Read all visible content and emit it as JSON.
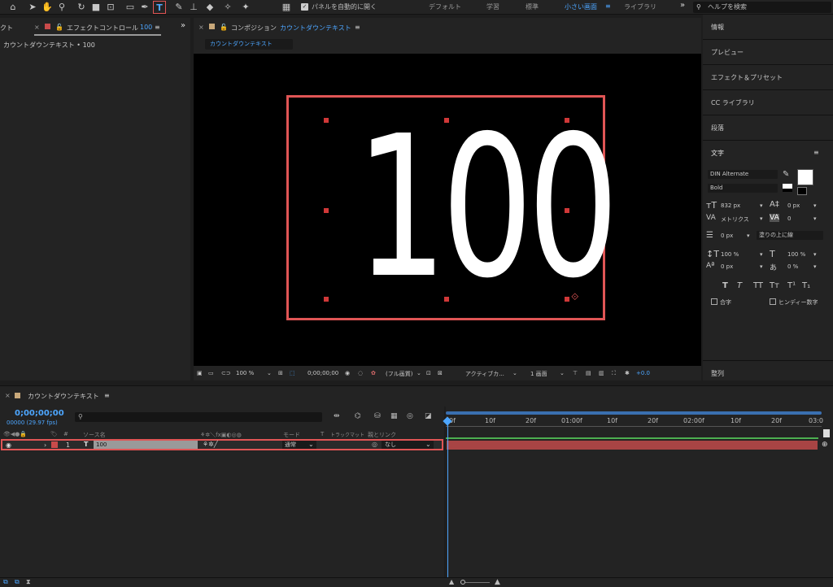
{
  "toolbar": {
    "auto_panel_label": "パネルを自動的に開く",
    "workspaces": [
      "デフォルト",
      "学習",
      "標準",
      "小さい画面",
      "ライブラリ"
    ],
    "active_workspace": "小さい画面",
    "more": "»",
    "help_placeholder": "ヘルプを検索"
  },
  "left_panel": {
    "cut_tab": "クト",
    "tab": "エフェクトコントロール",
    "tab_value": "100",
    "subtitle": "カウントダウンテキスト • 100",
    "more": "»"
  },
  "composition": {
    "tab_prefix": "コンポジション",
    "tab_name": "カウントダウンテキスト",
    "subtab": "カウントダウンテキスト",
    "display_text": "100",
    "footer": {
      "zoom": "100 %",
      "timecode": "0;00;00;00",
      "quality": "(フル画質)",
      "camera": "アクティブカ...",
      "views": "1 画面",
      "exposure": "+0.0"
    }
  },
  "right_panel": {
    "items": [
      "情報",
      "プレビュー",
      "エフェクト＆プリセット",
      "CC ライブラリ",
      "段落"
    ],
    "character_title": "文字",
    "font_family": "DIN Alternate",
    "font_style": "Bold",
    "font_size": "832 px",
    "leading": "0 px",
    "kerning": "メトリクス",
    "tracking": "0",
    "stroke_width": "0 px",
    "stroke_mode": "塗りの上に線",
    "vscale": "100 %",
    "hscale": "100 %",
    "baseline": "0 px",
    "tsume": "0 %",
    "ligature": "合字",
    "hindi_digits": "ヒンディー数字",
    "bottom_item": "整列"
  },
  "timeline": {
    "tab": "カウントダウンテキスト",
    "timecode": "0;00;00;00",
    "frames": "00000 (29.97 fps)",
    "columns": {
      "hash": "#",
      "source": "ソース名",
      "mode": "モード",
      "t": "T",
      "trackmatte": "トラックマット",
      "parent": "親とリンク"
    },
    "ruler": [
      "0f",
      "10f",
      "20f",
      "01:00f",
      "10f",
      "20f",
      "02:00f",
      "10f",
      "20f",
      "03:0"
    ],
    "layer": {
      "index": "1",
      "type_icon": "T",
      "name": "100",
      "mode": "通常",
      "parent": "なし"
    }
  },
  "colors": {
    "accent_blue": "#4da6ff",
    "highlight_red": "#e05555",
    "layer_bar": "#a84444"
  }
}
